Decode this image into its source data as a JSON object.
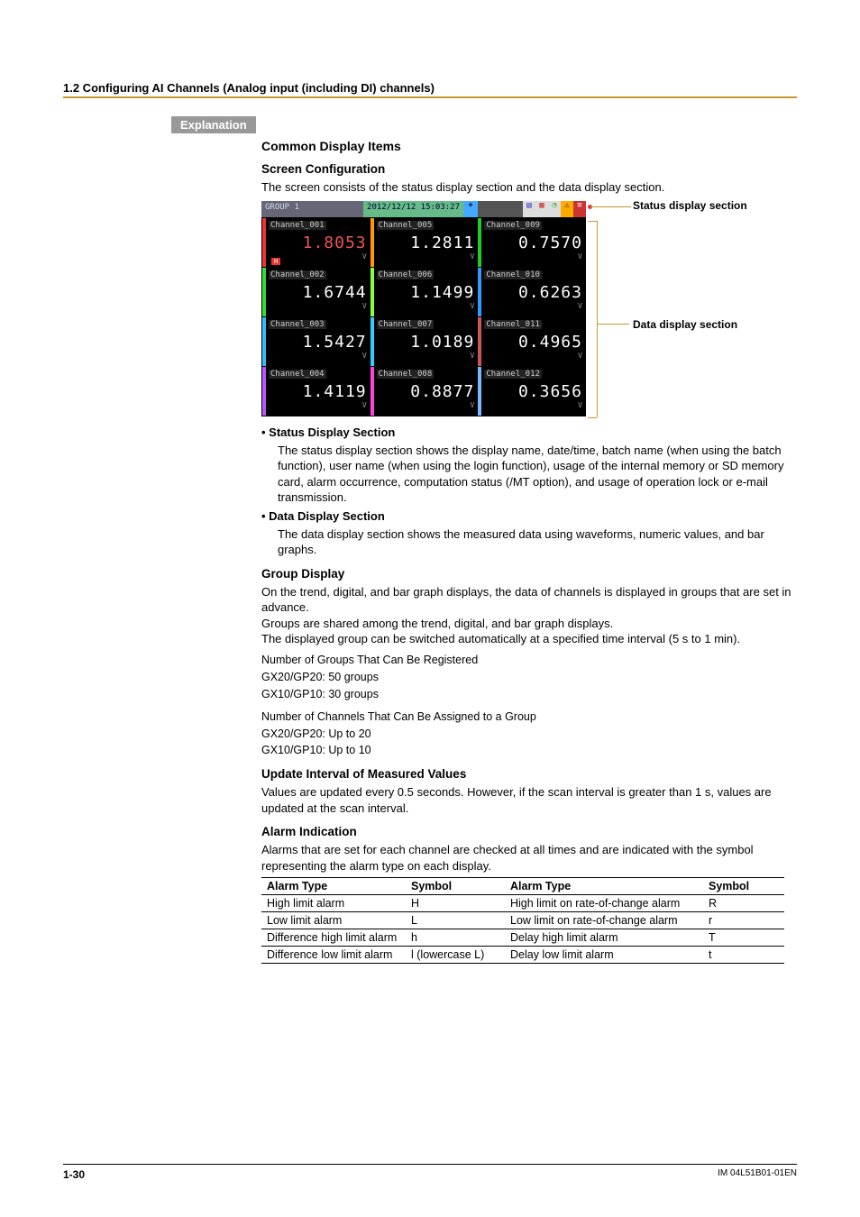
{
  "header": {
    "section": "1.2  Configuring AI Channels (Analog input (including DI) channels)"
  },
  "labels": {
    "explanation": "Explanation",
    "common_display_items": "Common Display Items",
    "screen_configuration": "Screen Configuration",
    "screen_config_text": "The screen consists of the status display section and the data display section.",
    "status_callout": "Status display section",
    "data_callout": "Data display section",
    "status_title": "Status Display Section",
    "status_body": "The status display section shows the display name, date/time, batch name (when using the batch function), user name (when using the login function), usage of the internal memory or SD memory card, alarm occurrence, computation status (/MT option), and usage of operation lock or e-mail transmission.",
    "data_title": "Data Display Section",
    "data_body": "The data display section shows the measured data using waveforms, numeric values, and bar graphs.",
    "group_display": "Group Display",
    "group_p1": "On the trend, digital, and bar graph displays, the data of channels is displayed in groups that are set in advance.",
    "group_p2": "Groups are shared among the trend, digital, and bar graph displays.",
    "group_p3": "The displayed group can be switched automatically at a specified time interval (5 s to 1 min).",
    "group_num_groups": "Number of Groups That Can Be Registered",
    "group_g1": "GX20/GP20: 50 groups",
    "group_g2": "GX10/GP10: 30 groups",
    "group_num_ch": "Number of Channels That Can Be Assigned to a Group",
    "group_c1": "GX20/GP20: Up to 20",
    "group_c2": "GX10/GP10: Up to 10",
    "update_h": "Update Interval of Measured Values",
    "update_body": "Values are updated every 0.5 seconds. However, if the scan interval is greater than 1 s, values are updated at the scan interval.",
    "alarm_h": "Alarm Indication",
    "alarm_body": "Alarms that are set for each channel are checked at all times and are indicated with the symbol representing the alarm type on each display."
  },
  "screenshot": {
    "group": "GROUP 1",
    "datetime": "2012/12/12 15:03:27",
    "unit": "V",
    "alarm_badge": "H",
    "channels": [
      {
        "name": "Channel_001",
        "val": "1.8053",
        "cls": "c1",
        "alarm": true
      },
      {
        "name": "Channel_005",
        "val": "1.2811",
        "cls": "c5"
      },
      {
        "name": "Channel_009",
        "val": "0.7570",
        "cls": "c9"
      },
      {
        "name": "Channel_002",
        "val": "1.6744",
        "cls": "c2"
      },
      {
        "name": "Channel_006",
        "val": "1.1499",
        "cls": "c6"
      },
      {
        "name": "Channel_010",
        "val": "0.6263",
        "cls": "c10"
      },
      {
        "name": "Channel_003",
        "val": "1.5427",
        "cls": "c3"
      },
      {
        "name": "Channel_007",
        "val": "1.0189",
        "cls": "c7"
      },
      {
        "name": "Channel_011",
        "val": "0.4965",
        "cls": "c11"
      },
      {
        "name": "Channel_004",
        "val": "1.4119",
        "cls": "c4"
      },
      {
        "name": "Channel_008",
        "val": "0.8877",
        "cls": "c8"
      },
      {
        "name": "Channel_012",
        "val": "0.3656",
        "cls": "c12"
      }
    ]
  },
  "alarm_table": {
    "headers": [
      "Alarm Type",
      "Symbol",
      "Alarm Type",
      "Symbol"
    ],
    "rows": [
      [
        "High limit alarm",
        "H",
        "High limit on rate-of-change alarm",
        "R"
      ],
      [
        "Low limit alarm",
        "L",
        "Low limit on rate-of-change alarm",
        "r"
      ],
      [
        "Difference high limit alarm",
        "h",
        "Delay high limit alarm",
        "T"
      ],
      [
        "Difference low limit alarm",
        "l (lowercase L)",
        "Delay low limit alarm",
        "t"
      ]
    ]
  },
  "footer": {
    "page": "1-30",
    "doc": "IM 04L51B01-01EN"
  }
}
